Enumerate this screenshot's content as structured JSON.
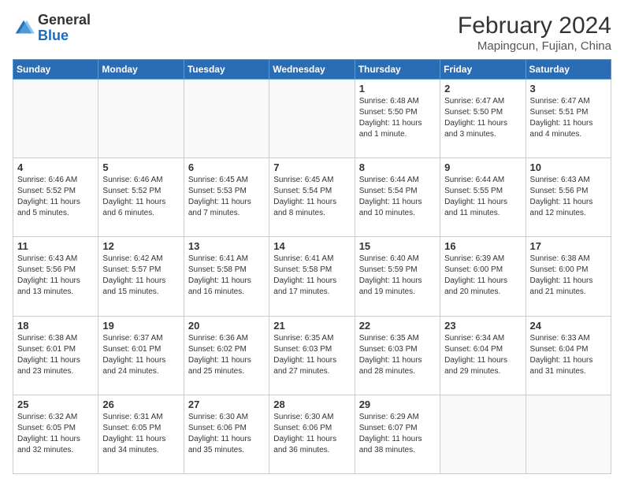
{
  "logo": {
    "general": "General",
    "blue": "Blue"
  },
  "header": {
    "title": "February 2024",
    "subtitle": "Mapingcun, Fujian, China"
  },
  "weekdays": [
    "Sunday",
    "Monday",
    "Tuesday",
    "Wednesday",
    "Thursday",
    "Friday",
    "Saturday"
  ],
  "weeks": [
    [
      {
        "day": "",
        "info": ""
      },
      {
        "day": "",
        "info": ""
      },
      {
        "day": "",
        "info": ""
      },
      {
        "day": "",
        "info": ""
      },
      {
        "day": "1",
        "info": "Sunrise: 6:48 AM\nSunset: 5:50 PM\nDaylight: 11 hours and 1 minute."
      },
      {
        "day": "2",
        "info": "Sunrise: 6:47 AM\nSunset: 5:50 PM\nDaylight: 11 hours and 3 minutes."
      },
      {
        "day": "3",
        "info": "Sunrise: 6:47 AM\nSunset: 5:51 PM\nDaylight: 11 hours and 4 minutes."
      }
    ],
    [
      {
        "day": "4",
        "info": "Sunrise: 6:46 AM\nSunset: 5:52 PM\nDaylight: 11 hours and 5 minutes."
      },
      {
        "day": "5",
        "info": "Sunrise: 6:46 AM\nSunset: 5:52 PM\nDaylight: 11 hours and 6 minutes."
      },
      {
        "day": "6",
        "info": "Sunrise: 6:45 AM\nSunset: 5:53 PM\nDaylight: 11 hours and 7 minutes."
      },
      {
        "day": "7",
        "info": "Sunrise: 6:45 AM\nSunset: 5:54 PM\nDaylight: 11 hours and 8 minutes."
      },
      {
        "day": "8",
        "info": "Sunrise: 6:44 AM\nSunset: 5:54 PM\nDaylight: 11 hours and 10 minutes."
      },
      {
        "day": "9",
        "info": "Sunrise: 6:44 AM\nSunset: 5:55 PM\nDaylight: 11 hours and 11 minutes."
      },
      {
        "day": "10",
        "info": "Sunrise: 6:43 AM\nSunset: 5:56 PM\nDaylight: 11 hours and 12 minutes."
      }
    ],
    [
      {
        "day": "11",
        "info": "Sunrise: 6:43 AM\nSunset: 5:56 PM\nDaylight: 11 hours and 13 minutes."
      },
      {
        "day": "12",
        "info": "Sunrise: 6:42 AM\nSunset: 5:57 PM\nDaylight: 11 hours and 15 minutes."
      },
      {
        "day": "13",
        "info": "Sunrise: 6:41 AM\nSunset: 5:58 PM\nDaylight: 11 hours and 16 minutes."
      },
      {
        "day": "14",
        "info": "Sunrise: 6:41 AM\nSunset: 5:58 PM\nDaylight: 11 hours and 17 minutes."
      },
      {
        "day": "15",
        "info": "Sunrise: 6:40 AM\nSunset: 5:59 PM\nDaylight: 11 hours and 19 minutes."
      },
      {
        "day": "16",
        "info": "Sunrise: 6:39 AM\nSunset: 6:00 PM\nDaylight: 11 hours and 20 minutes."
      },
      {
        "day": "17",
        "info": "Sunrise: 6:38 AM\nSunset: 6:00 PM\nDaylight: 11 hours and 21 minutes."
      }
    ],
    [
      {
        "day": "18",
        "info": "Sunrise: 6:38 AM\nSunset: 6:01 PM\nDaylight: 11 hours and 23 minutes."
      },
      {
        "day": "19",
        "info": "Sunrise: 6:37 AM\nSunset: 6:01 PM\nDaylight: 11 hours and 24 minutes."
      },
      {
        "day": "20",
        "info": "Sunrise: 6:36 AM\nSunset: 6:02 PM\nDaylight: 11 hours and 25 minutes."
      },
      {
        "day": "21",
        "info": "Sunrise: 6:35 AM\nSunset: 6:03 PM\nDaylight: 11 hours and 27 minutes."
      },
      {
        "day": "22",
        "info": "Sunrise: 6:35 AM\nSunset: 6:03 PM\nDaylight: 11 hours and 28 minutes."
      },
      {
        "day": "23",
        "info": "Sunrise: 6:34 AM\nSunset: 6:04 PM\nDaylight: 11 hours and 29 minutes."
      },
      {
        "day": "24",
        "info": "Sunrise: 6:33 AM\nSunset: 6:04 PM\nDaylight: 11 hours and 31 minutes."
      }
    ],
    [
      {
        "day": "25",
        "info": "Sunrise: 6:32 AM\nSunset: 6:05 PM\nDaylight: 11 hours and 32 minutes."
      },
      {
        "day": "26",
        "info": "Sunrise: 6:31 AM\nSunset: 6:05 PM\nDaylight: 11 hours and 34 minutes."
      },
      {
        "day": "27",
        "info": "Sunrise: 6:30 AM\nSunset: 6:06 PM\nDaylight: 11 hours and 35 minutes."
      },
      {
        "day": "28",
        "info": "Sunrise: 6:30 AM\nSunset: 6:06 PM\nDaylight: 11 hours and 36 minutes."
      },
      {
        "day": "29",
        "info": "Sunrise: 6:29 AM\nSunset: 6:07 PM\nDaylight: 11 hours and 38 minutes."
      },
      {
        "day": "",
        "info": ""
      },
      {
        "day": "",
        "info": ""
      }
    ]
  ]
}
